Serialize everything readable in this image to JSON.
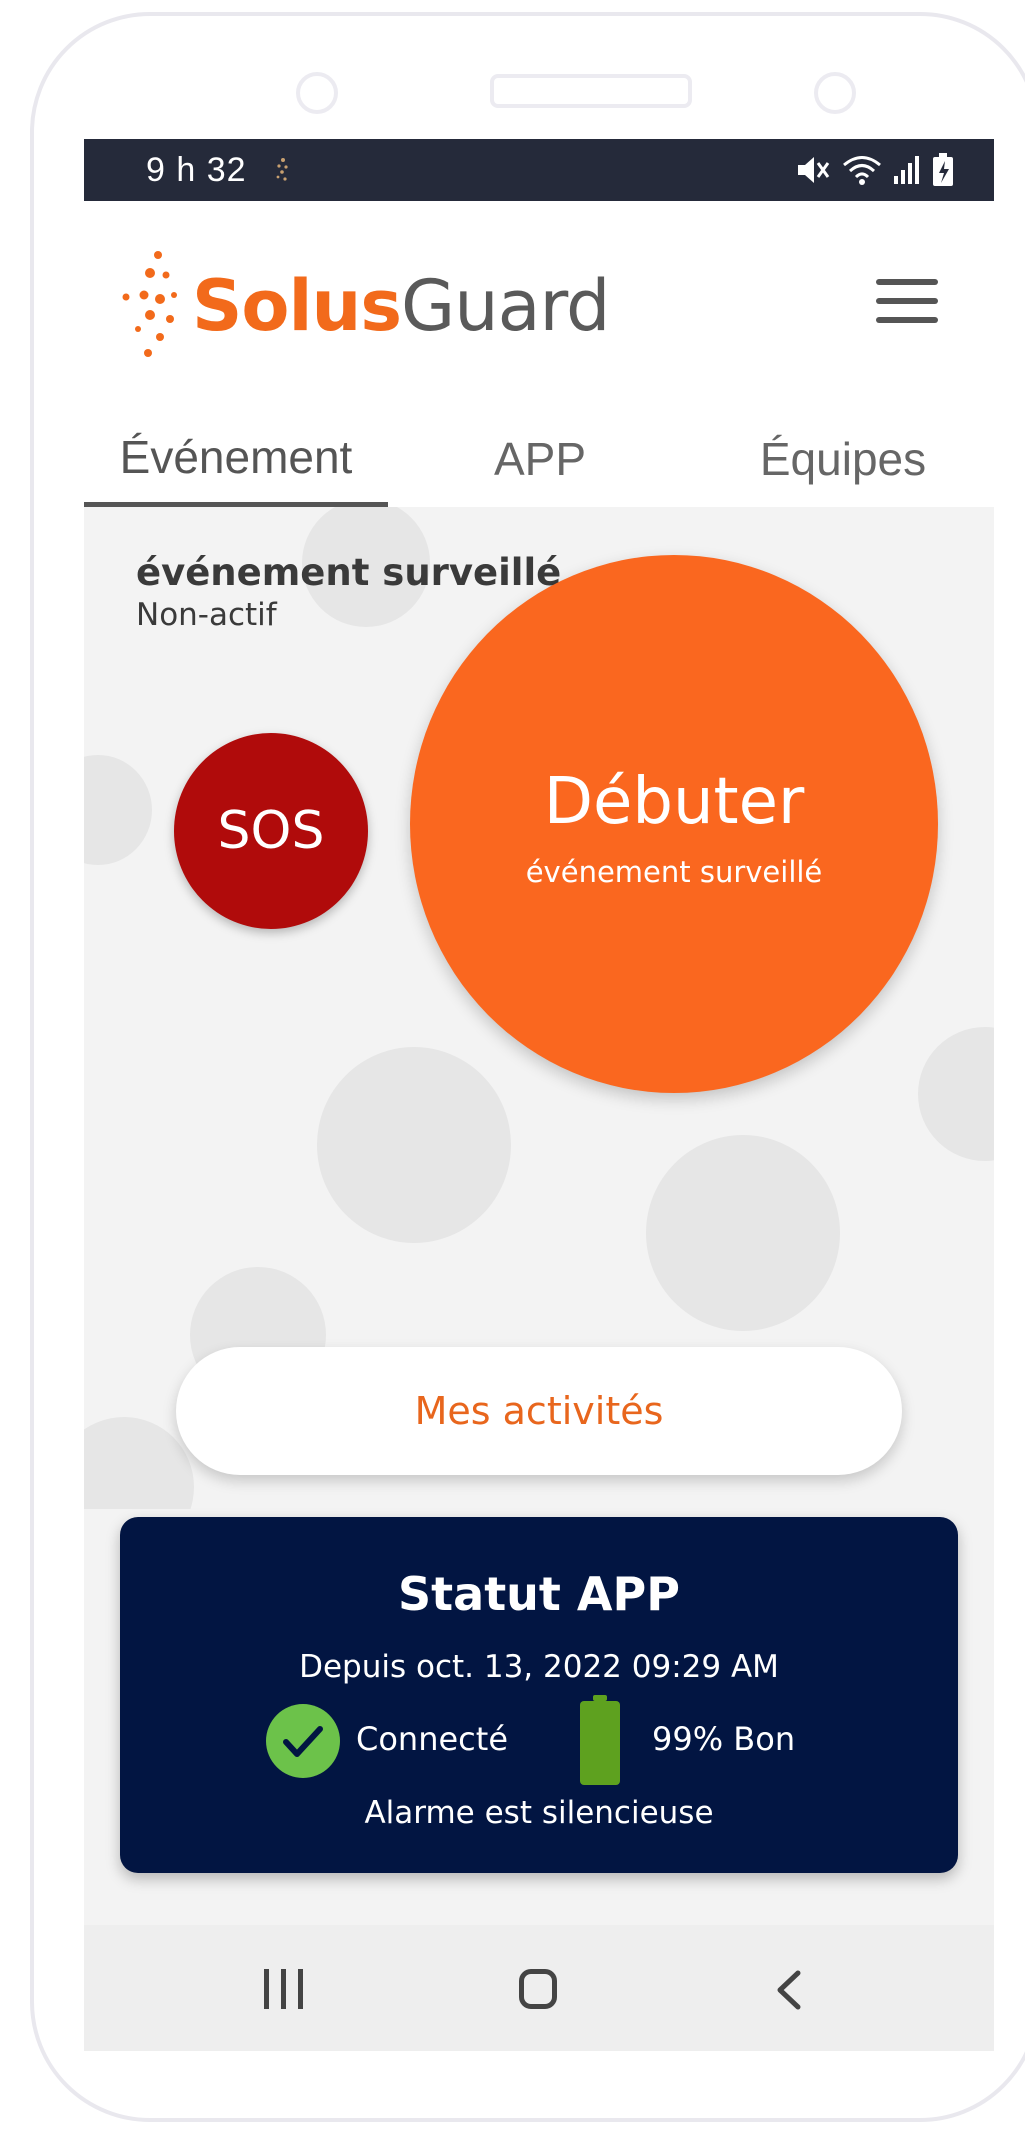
{
  "status_bar": {
    "time": "9 h 32"
  },
  "header": {
    "logo_part1": "Solus",
    "logo_part2": "Guard",
    "brand_color": "#f26a1b"
  },
  "tabs": [
    {
      "label": "Événement",
      "active": true
    },
    {
      "label": "APP",
      "active": false
    },
    {
      "label": "Équipes",
      "active": false
    }
  ],
  "event": {
    "title": "événement surveillé",
    "status": "Non-actif"
  },
  "buttons": {
    "sos_label": "SOS",
    "start_label": "Débuter",
    "start_sublabel": "événement surveillé",
    "activities_label": "Mes activités"
  },
  "status_card": {
    "title": "Statut APP",
    "since": "Depuis oct. 13, 2022 09:29 AM",
    "connection": "Connecté",
    "battery": "99% Bon",
    "alarm": "Alarme est silencieuse",
    "battery_level": 0.99
  },
  "colors": {
    "sos": "#b00b0b",
    "start": "#fa671f",
    "card_bg": "#021542",
    "connected": "#6cc24a",
    "battery": "#5ea11f"
  },
  "icons": [
    "spark-icon",
    "mute-icon",
    "wifi-icon",
    "signal-icon",
    "battery-charging-icon",
    "menu-icon",
    "check-icon",
    "battery-icon",
    "recent-apps-icon",
    "home-icon",
    "back-icon"
  ]
}
